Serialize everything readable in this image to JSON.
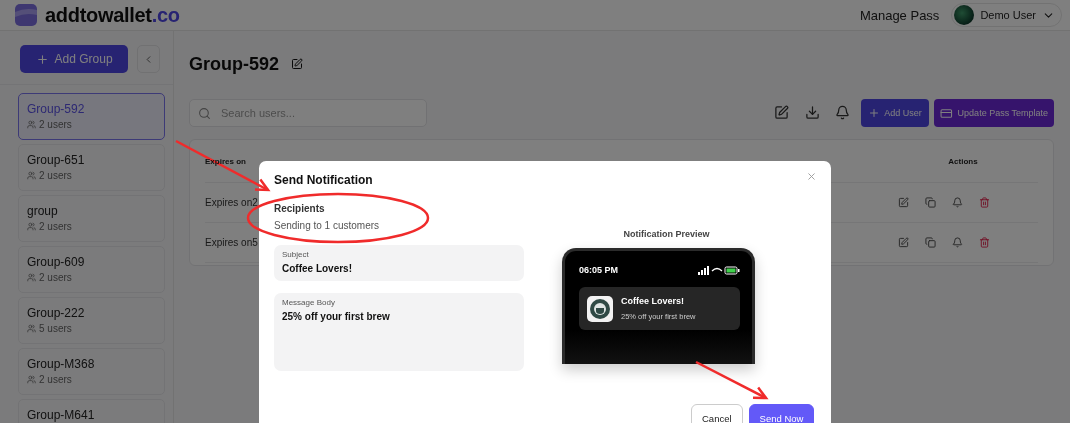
{
  "brand": {
    "name": "addtowallet",
    "suffix": ".co"
  },
  "header": {
    "link": "Manage Pass",
    "user": "Demo User"
  },
  "sidebar": {
    "add_button": "Add Group",
    "groups": [
      {
        "name": "Group-592",
        "users": "2 users",
        "selected": true
      },
      {
        "name": "Group-651",
        "users": "2 users",
        "selected": false
      },
      {
        "name": "group",
        "users": "2 users",
        "selected": false
      },
      {
        "name": "Group-609",
        "users": "2 users",
        "selected": false
      },
      {
        "name": "Group-222",
        "users": "5 users",
        "selected": false
      },
      {
        "name": "Group-M368",
        "users": "2 users",
        "selected": false
      },
      {
        "name": "Group-M641",
        "selected": false
      }
    ]
  },
  "group_title": "Group-592",
  "toolbar": {
    "search_placeholder": "Search users...",
    "add_user": "Add User",
    "update_template": "Update Pass Template"
  },
  "table": {
    "columns": [
      "Expires on",
      "Actions"
    ],
    "rows": [
      {
        "expires": "Expires on2"
      },
      {
        "expires": "Expires on5"
      }
    ]
  },
  "modal": {
    "title": "Send Notification",
    "recipients_label": "Recipients",
    "recipients_text": "Sending to 1 customers",
    "subject": {
      "label": "Subject",
      "value": "Coffee Lovers!"
    },
    "message": {
      "label": "Message Body",
      "value": "25% off your first brew"
    },
    "preview": {
      "title": "Notification Preview",
      "time": "06:05 PM",
      "notification_title": "Coffee Lovers!",
      "notification_body": "25% off your first brew"
    },
    "buttons": [
      {
        "label": "Cancel",
        "kind": "secondary"
      },
      {
        "label": "Send Now",
        "kind": "primary"
      }
    ]
  }
}
